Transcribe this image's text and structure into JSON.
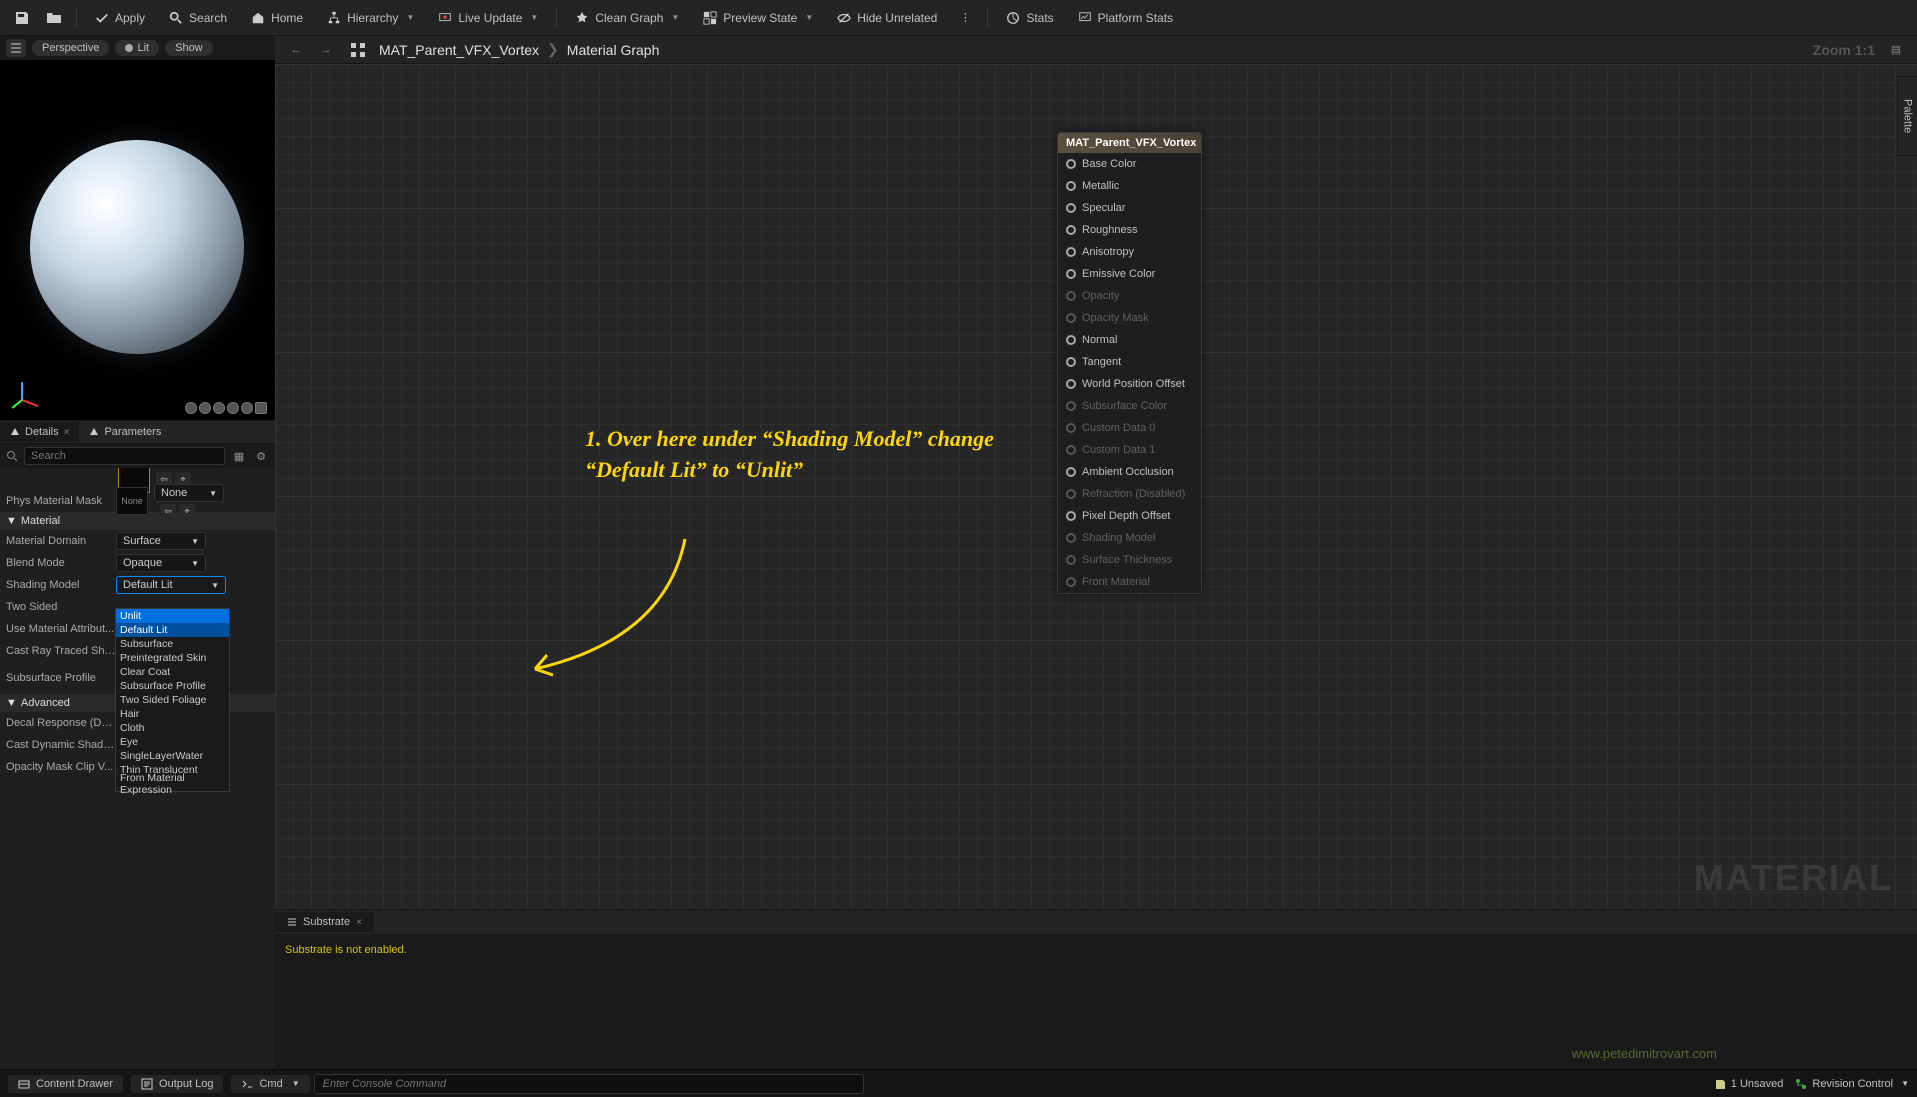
{
  "toolbar": {
    "apply": "Apply",
    "search": "Search",
    "home": "Home",
    "hierarchy": "Hierarchy",
    "live_update": "Live Update",
    "clean_graph": "Clean Graph",
    "preview_state": "Preview State",
    "hide_unrelated": "Hide Unrelated",
    "stats": "Stats",
    "platform_stats": "Platform Stats"
  },
  "viewport": {
    "perspective": "Perspective",
    "lit": "Lit",
    "show": "Show"
  },
  "breadcrumb": {
    "asset": "MAT_Parent_VFX_Vortex",
    "section": "Material Graph",
    "zoom": "Zoom 1:1"
  },
  "palette_label": "Palette",
  "tabs": {
    "details": "Details",
    "parameters": "Parameters"
  },
  "search_placeholder": "Search",
  "details": {
    "phys_mask_label": "Phys Material Mask",
    "phys_mask_none": "None",
    "material_header": "Material",
    "domain_label": "Material Domain",
    "domain_value": "Surface",
    "blend_label": "Blend Mode",
    "blend_value": "Opaque",
    "shading_label": "Shading Model",
    "shading_value": "Default Lit",
    "two_sided": "Two Sided",
    "use_mat_attr": "Use Material Attribut...",
    "cast_ray": "Cast Ray Traced Sha...",
    "subsurface_profile": "Subsurface Profile",
    "advanced_header": "Advanced",
    "decal_response": "Decal Response (DB...",
    "cast_dynamic": "Cast Dynamic Shado...",
    "opacity_clip": "Opacity Mask Clip V..."
  },
  "shading_options": [
    "Unlit",
    "Default Lit",
    "Subsurface",
    "Preintegrated Skin",
    "Clear Coat",
    "Subsurface Profile",
    "Two Sided Foliage",
    "Hair",
    "Cloth",
    "Eye",
    "SingleLayerWater",
    "Thin Translucent",
    "From Material Expression"
  ],
  "material_node": {
    "title": "MAT_Parent_VFX_Vortex",
    "pins": [
      {
        "label": "Base Color",
        "enabled": true
      },
      {
        "label": "Metallic",
        "enabled": true
      },
      {
        "label": "Specular",
        "enabled": true
      },
      {
        "label": "Roughness",
        "enabled": true
      },
      {
        "label": "Anisotropy",
        "enabled": true
      },
      {
        "label": "Emissive Color",
        "enabled": true
      },
      {
        "label": "Opacity",
        "enabled": false
      },
      {
        "label": "Opacity Mask",
        "enabled": false
      },
      {
        "label": "Normal",
        "enabled": true
      },
      {
        "label": "Tangent",
        "enabled": true
      },
      {
        "label": "World Position Offset",
        "enabled": true
      },
      {
        "label": "Subsurface Color",
        "enabled": false
      },
      {
        "label": "Custom Data 0",
        "enabled": false
      },
      {
        "label": "Custom Data 1",
        "enabled": false
      },
      {
        "label": "Ambient Occlusion",
        "enabled": true
      },
      {
        "label": "Refraction (Disabled)",
        "enabled": false
      },
      {
        "label": "Pixel Depth Offset",
        "enabled": true
      },
      {
        "label": "Shading Model",
        "enabled": false
      },
      {
        "label": "Surface Thickness",
        "enabled": false
      },
      {
        "label": "Front Material",
        "enabled": false
      }
    ]
  },
  "annotation": "1. Over here under “Shading Model” change “Default Lit” to “Unlit”",
  "substrate": {
    "tab": "Substrate",
    "message": "Substrate is not enabled."
  },
  "watermark": "MATERIAL",
  "url_watermark": "www.petedimitrovart.com",
  "bottom": {
    "content_drawer": "Content Drawer",
    "output_log": "Output Log",
    "cmd": "Cmd",
    "cmd_placeholder": "Enter Console Command",
    "unsaved": "1 Unsaved",
    "revision": "Revision Control"
  }
}
